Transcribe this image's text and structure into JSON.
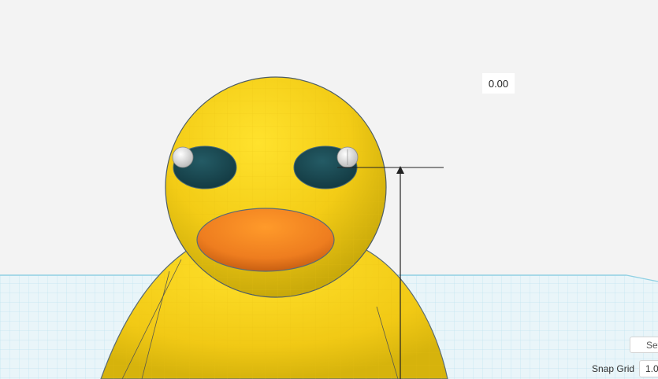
{
  "workplane": {
    "measurement_value": "0.00"
  },
  "controls": {
    "settings_label": "Settings",
    "snap_grid_label": "Snap Grid",
    "snap_grid_value": "1.0"
  },
  "colors": {
    "body_yellow": "#f4cf1a",
    "eye_teal": "#1c4a52",
    "beak_orange": "#ee7d1f",
    "grid_line": "#a9dcea",
    "background": "#f3f3f3"
  }
}
